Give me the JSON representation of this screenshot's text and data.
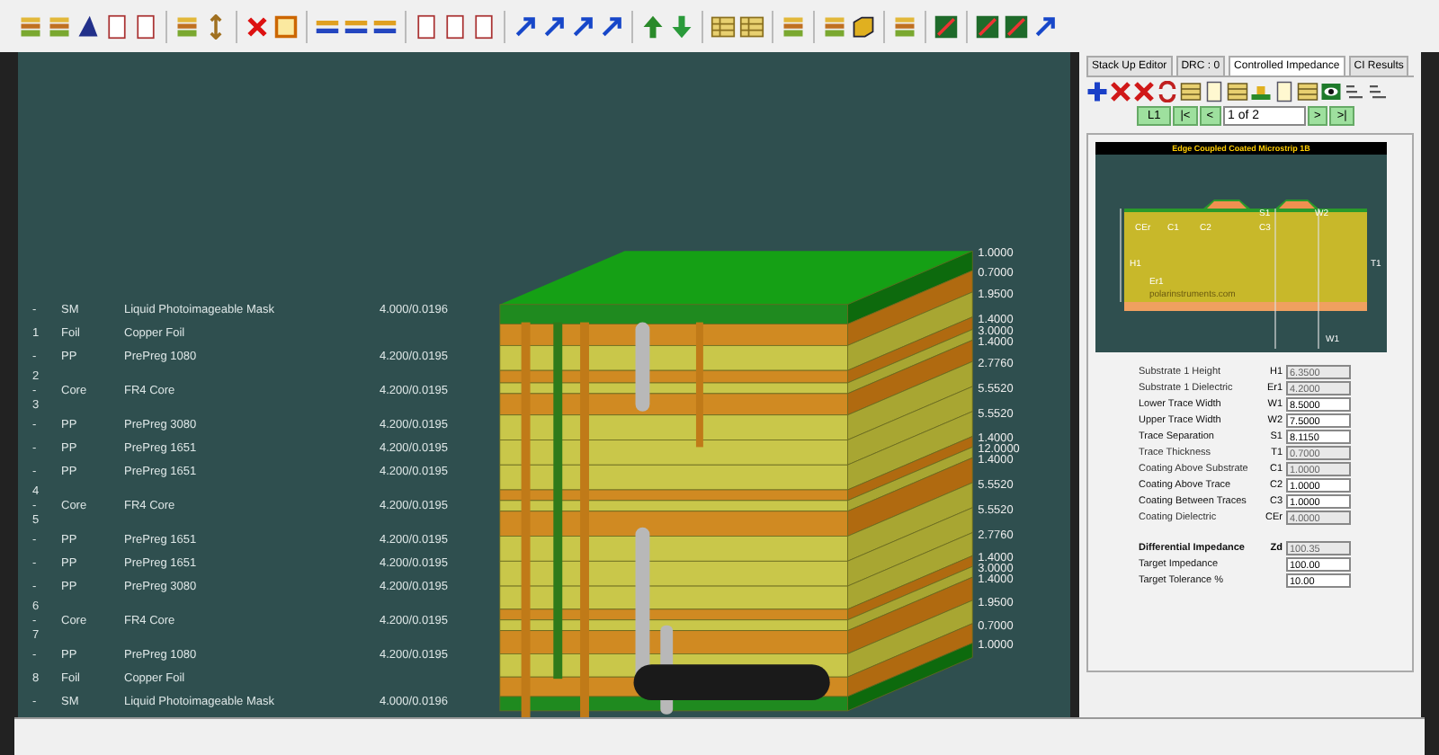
{
  "layers": [
    {
      "index_lines": [
        "-"
      ],
      "type": "SM",
      "material": "Liquid Photoimageable Mask",
      "value": "4.000/0.0196"
    },
    {
      "index_lines": [
        "1"
      ],
      "type": "Foil",
      "material": "Copper Foil"
    },
    {
      "index_lines": [
        "-"
      ],
      "type": "PP",
      "material": "PrePreg 1080",
      "value": "4.200/0.0195"
    },
    {
      "index_lines": [
        "2",
        "-",
        "3"
      ],
      "type": "Core",
      "material": "FR4 Core",
      "value": "4.200/0.0195"
    },
    {
      "index_lines": [
        "-"
      ],
      "type": "PP",
      "material": "PrePreg 3080",
      "value": "4.200/0.0195"
    },
    {
      "index_lines": [
        "-"
      ],
      "type": "PP",
      "material": "PrePreg 1651",
      "value": "4.200/0.0195"
    },
    {
      "index_lines": [
        "-"
      ],
      "type": "PP",
      "material": "PrePreg 1651",
      "value": "4.200/0.0195"
    },
    {
      "index_lines": [
        "4",
        "-",
        "5"
      ],
      "type": "Core",
      "material": "FR4 Core",
      "value": "4.200/0.0195"
    },
    {
      "index_lines": [
        "-"
      ],
      "type": "PP",
      "material": "PrePreg 1651",
      "value": "4.200/0.0195"
    },
    {
      "index_lines": [
        "-"
      ],
      "type": "PP",
      "material": "PrePreg 1651",
      "value": "4.200/0.0195"
    },
    {
      "index_lines": [
        "-"
      ],
      "type": "PP",
      "material": "PrePreg 3080",
      "value": "4.200/0.0195"
    },
    {
      "index_lines": [
        "6",
        "-",
        "7"
      ],
      "type": "Core",
      "material": "FR4 Core",
      "value": "4.200/0.0195"
    },
    {
      "index_lines": [
        "-"
      ],
      "type": "PP",
      "material": "PrePreg 1080",
      "value": "4.200/0.0195"
    },
    {
      "index_lines": [
        "8"
      ],
      "type": "Foil",
      "material": "Copper Foil"
    },
    {
      "index_lines": [
        "-"
      ],
      "type": "SM",
      "material": "Liquid Photoimageable Mask",
      "value": "4.000/0.0196"
    }
  ],
  "thickness_labels": [
    "1.0000",
    "0.7000",
    "1.9500",
    "1.4000",
    "3.0000",
    "1.4000",
    "2.7760",
    "5.5520",
    "5.5520",
    "1.4000",
    "12.0000",
    "1.4000",
    "5.5520",
    "5.5520",
    "2.7760",
    "1.4000",
    "3.0000",
    "1.4000",
    "1.9500",
    "0.7000",
    "1.0000"
  ],
  "impedance_panel": {
    "tabs": [
      {
        "label": "Stack Up Editor",
        "selected": false
      },
      {
        "label": "DRC : 0",
        "selected": false
      },
      {
        "label": "Controlled Impedance",
        "selected": true
      },
      {
        "label": "CI Results",
        "selected": false
      }
    ],
    "nav": {
      "layer": "L1",
      "first": "|<",
      "prev": "<",
      "page": "1 of 2",
      "next": ">",
      "last": ">|"
    },
    "diagram": {
      "title": "Edge Coupled Coated Microstrip 1B",
      "labels": [
        "CEr",
        "C1",
        "C2",
        "S1",
        "C3",
        "W2",
        "T1",
        "H1",
        "Er1",
        "W1"
      ],
      "credit": "polarinstruments.com"
    },
    "parameters": [
      {
        "label": "Substrate 1 Height",
        "symbol": "H1",
        "value": "6.3500",
        "editable": false
      },
      {
        "label": "Substrate 1 Dielectric",
        "symbol": "Er1",
        "value": "4.2000",
        "editable": false
      },
      {
        "label": "Lower Trace Width",
        "symbol": "W1",
        "value": "8.5000",
        "editable": true
      },
      {
        "label": "Upper Trace Width",
        "symbol": "W2",
        "value": "7.5000",
        "editable": true
      },
      {
        "label": "Trace Separation",
        "symbol": "S1",
        "value": "8.1150",
        "editable": true
      },
      {
        "label": "Trace Thickness",
        "symbol": "T1",
        "value": "0.7000",
        "editable": false
      },
      {
        "label": "Coating Above Substrate",
        "symbol": "C1",
        "value": "1.0000",
        "editable": false
      },
      {
        "label": "Coating Above Trace",
        "symbol": "C2",
        "value": "1.0000",
        "editable": true
      },
      {
        "label": "Coating Between Traces",
        "symbol": "C3",
        "value": "1.0000",
        "editable": true
      },
      {
        "label": "Coating Dielectric",
        "symbol": "CEr",
        "value": "4.0000",
        "editable": false
      }
    ],
    "results": [
      {
        "kind": "computed",
        "label": "Differential Impedance",
        "symbol": "Zd",
        "value": "100.35",
        "editable": false
      },
      {
        "kind": "target",
        "label": "Target Impedance",
        "value": "100.00",
        "editable": true
      },
      {
        "kind": "target",
        "label": "Target Tolerance %",
        "value": "10.00",
        "editable": true
      }
    ]
  }
}
